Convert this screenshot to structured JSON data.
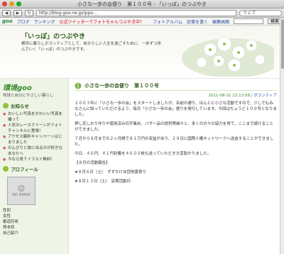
{
  "window": {
    "title": "小さな一歩の会便り　第１００号 - 「いっぽ」のつぶやき"
  },
  "toolbar": {
    "url": "http://blog.goo.ne.jp/ippo...",
    "search_placeholder": "ウェブ"
  },
  "goo": {
    "logo": "goo",
    "links": [
      "ブログ",
      "ランキング"
    ],
    "twitter": "公式ツイッターでフォトちゃんつぶやき中！",
    "right_links": [
      "フォトアルバム",
      "記事を書く",
      "編集画面"
    ],
    "search_button": "検索"
  },
  "header": {
    "blog_title": "「いっぽ」のつぶやき",
    "blog_desc": "横浜に暮らしボランティアとして、自分らしい人生を過ごすために、一歩ずつ歩んでいく「いっぽ」のつぶやきです。"
  },
  "sidebar": {
    "env_logo": "環境goo",
    "env_sub": "地球と自分にやさしい暮らし",
    "news_title": "お知らせ",
    "news_items": [
      "おいしい写真をかわいい写真を撮って",
      "人気のレースクイーンがフォトチャンネルに登場！",
      "アクセス解析キャンペーンはじまりました",
      "のんびりと旅に出るのが好きなあなたへ",
      "今なら見てイラスト無料！"
    ],
    "profile_title": "プロフィール",
    "avatar_text": "NO IMAGE",
    "profile_lines": [
      "性別",
      "女性",
      "都道府県",
      "熊本県",
      "自己紹介"
    ]
  },
  "post": {
    "title": "小さな一歩の会便り　第１００号",
    "date": "2011-08-31 22:13:58",
    "category": "ボランティア",
    "paragraphs": [
      "２００３年に「小さな一歩の会」をスタートしましたが、名前の通り、ほんとに小さな活動ですので、少しでもみなさんに知っていただけるよう、毎月「小さな一歩の会」便りを発行しています。今回はちょうど１００号となりました。",
      "押し花しおり作りや使用済み切手集め、バザー品の提供等細々と、多くの方々の協力を得て、ここまで続けることができました。",
      "７月から８月までの２ヶ月間で８１万円の収益があり、２９日に国際人権ネットワークへ送金することができました。",
      "今日、４０円、４１円封書を４６００枚も送っていただき大変助かりました。",
      "【８月の活動報告】",
      "★８月６日（土）　ずずかけ台団地夏祭り",
      "★８月１３日（土）　定期活動日"
    ]
  }
}
